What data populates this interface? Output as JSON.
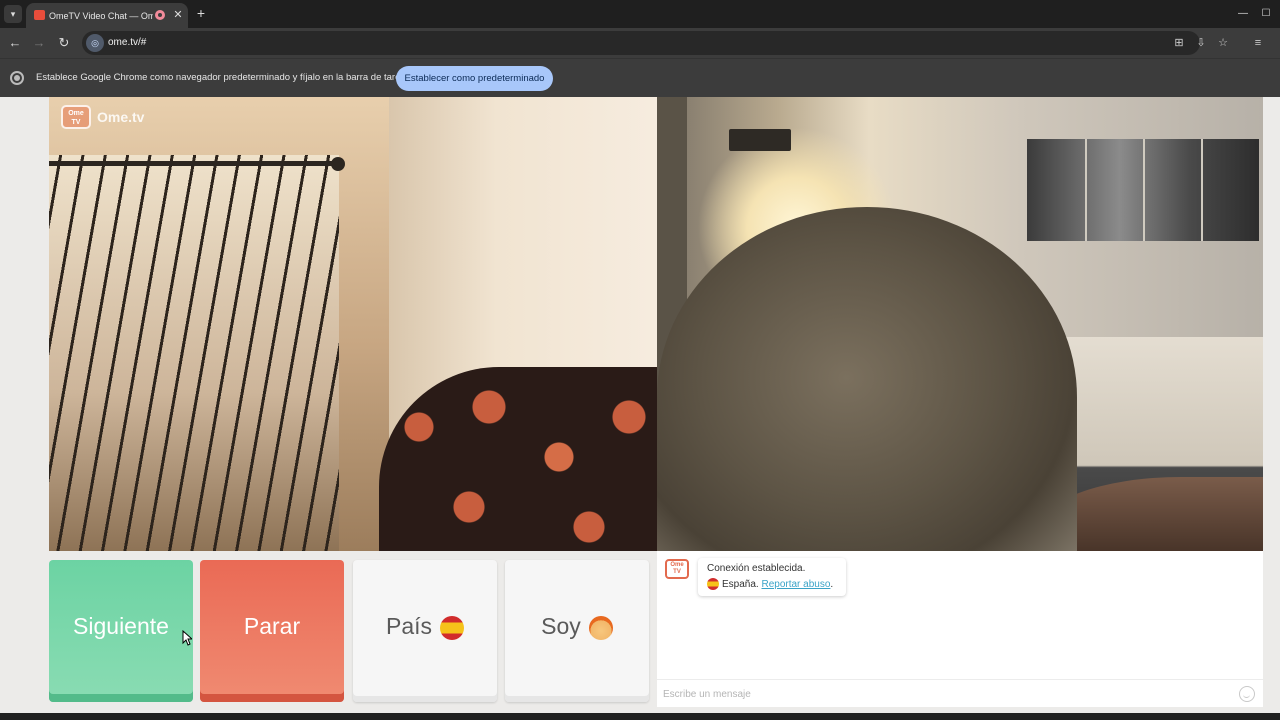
{
  "browser": {
    "tab_title": "OmeTV Video Chat — Ome",
    "tab_close": "✕",
    "new_tab": "+",
    "url": "ome.tv/#",
    "window_controls": {
      "minimize": "—",
      "maximize": "☐"
    },
    "icons": [
      "tab-list-icon",
      "back-icon",
      "forward-icon",
      "reload-icon",
      "site-info-icon",
      "translate-icon",
      "install-icon",
      "bookmark-star-icon",
      "tab-search-icon"
    ]
  },
  "infobar": {
    "text": "Establece Google Chrome como navegador predeterminado y fíjalo en la barra de tareas",
    "button": "Establecer como predeterminado"
  },
  "page": {
    "logo_text": "Ome.tv",
    "logo_badge": "Ome TV",
    "buttons": {
      "next": "Siguiente",
      "stop": "Parar",
      "country": "País",
      "gender": "Soy"
    },
    "chat": {
      "avatar_text": "Ome TV",
      "status": "Conexión establecida.",
      "country": "España.",
      "report": "Reportar abuso",
      "report_suffix": ".",
      "input_placeholder": "Escribe un mensaje"
    }
  },
  "colors": {
    "next_button": "#6cd3a3",
    "stop_button": "#ea6a55",
    "infobar_button": "#a8c7fa",
    "report_link": "#3aa3c7"
  }
}
